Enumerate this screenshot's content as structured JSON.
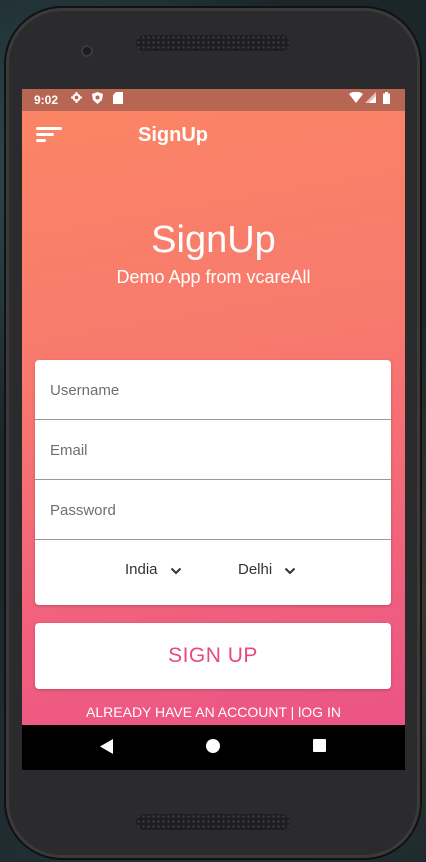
{
  "status_bar": {
    "time": "9:02",
    "left_icons": [
      "gear-icon",
      "shield-icon",
      "sd-card-icon"
    ],
    "right_icons": [
      "wifi-icon",
      "signal-icon",
      "battery-icon"
    ],
    "color": "#b86654"
  },
  "app_bar": {
    "title": "SignUp",
    "menu_icon": "menu-icon"
  },
  "hero": {
    "title": "SignUp",
    "subtitle": "Demo App from vcareAll"
  },
  "form": {
    "username": {
      "placeholder": "Username",
      "value": ""
    },
    "email": {
      "placeholder": "Email",
      "value": ""
    },
    "password": {
      "placeholder": "Password",
      "value": ""
    },
    "country": {
      "selected": "India"
    },
    "city": {
      "selected": "Delhi"
    }
  },
  "signup_button": {
    "label": "SIGN UP",
    "color": "#e94a7d"
  },
  "login_link": {
    "label": "ALREADY HAVE AN ACCOUNT | lOG IN"
  },
  "nav_bar": {
    "buttons": [
      "back-icon",
      "home-icon",
      "recents-icon"
    ]
  },
  "colors": {
    "gradient_start": "#fb8565",
    "gradient_end": "#eb5486"
  }
}
